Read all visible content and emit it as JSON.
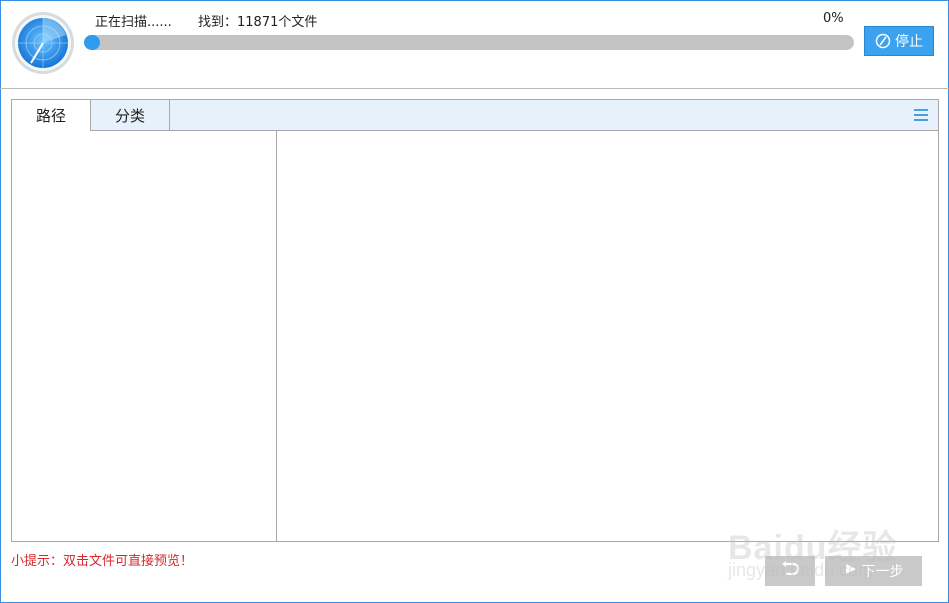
{
  "header": {
    "status": "正在扫描......",
    "found": "找到：11871个文件",
    "percent": "0%",
    "progress": 0.02,
    "stop_label": "停止"
  },
  "tabs": [
    {
      "label": "路径",
      "active": true
    },
    {
      "label": "分类",
      "active": false
    }
  ],
  "footer": {
    "tip": "小提示：双击文件可直接预览！",
    "next_label": "下一步"
  },
  "watermark": {
    "main": "Baidu经验",
    "sub": "jingyan.baidu.com"
  },
  "colors": {
    "accent": "#2d9bef",
    "tip": "#d9272e",
    "tab_strip": "#e6f1fc"
  },
  "icons": {
    "radar": "radar-icon",
    "stop": "stop-icon",
    "menu": "menu-icon",
    "back": "back-icon",
    "next": "next-icon"
  }
}
